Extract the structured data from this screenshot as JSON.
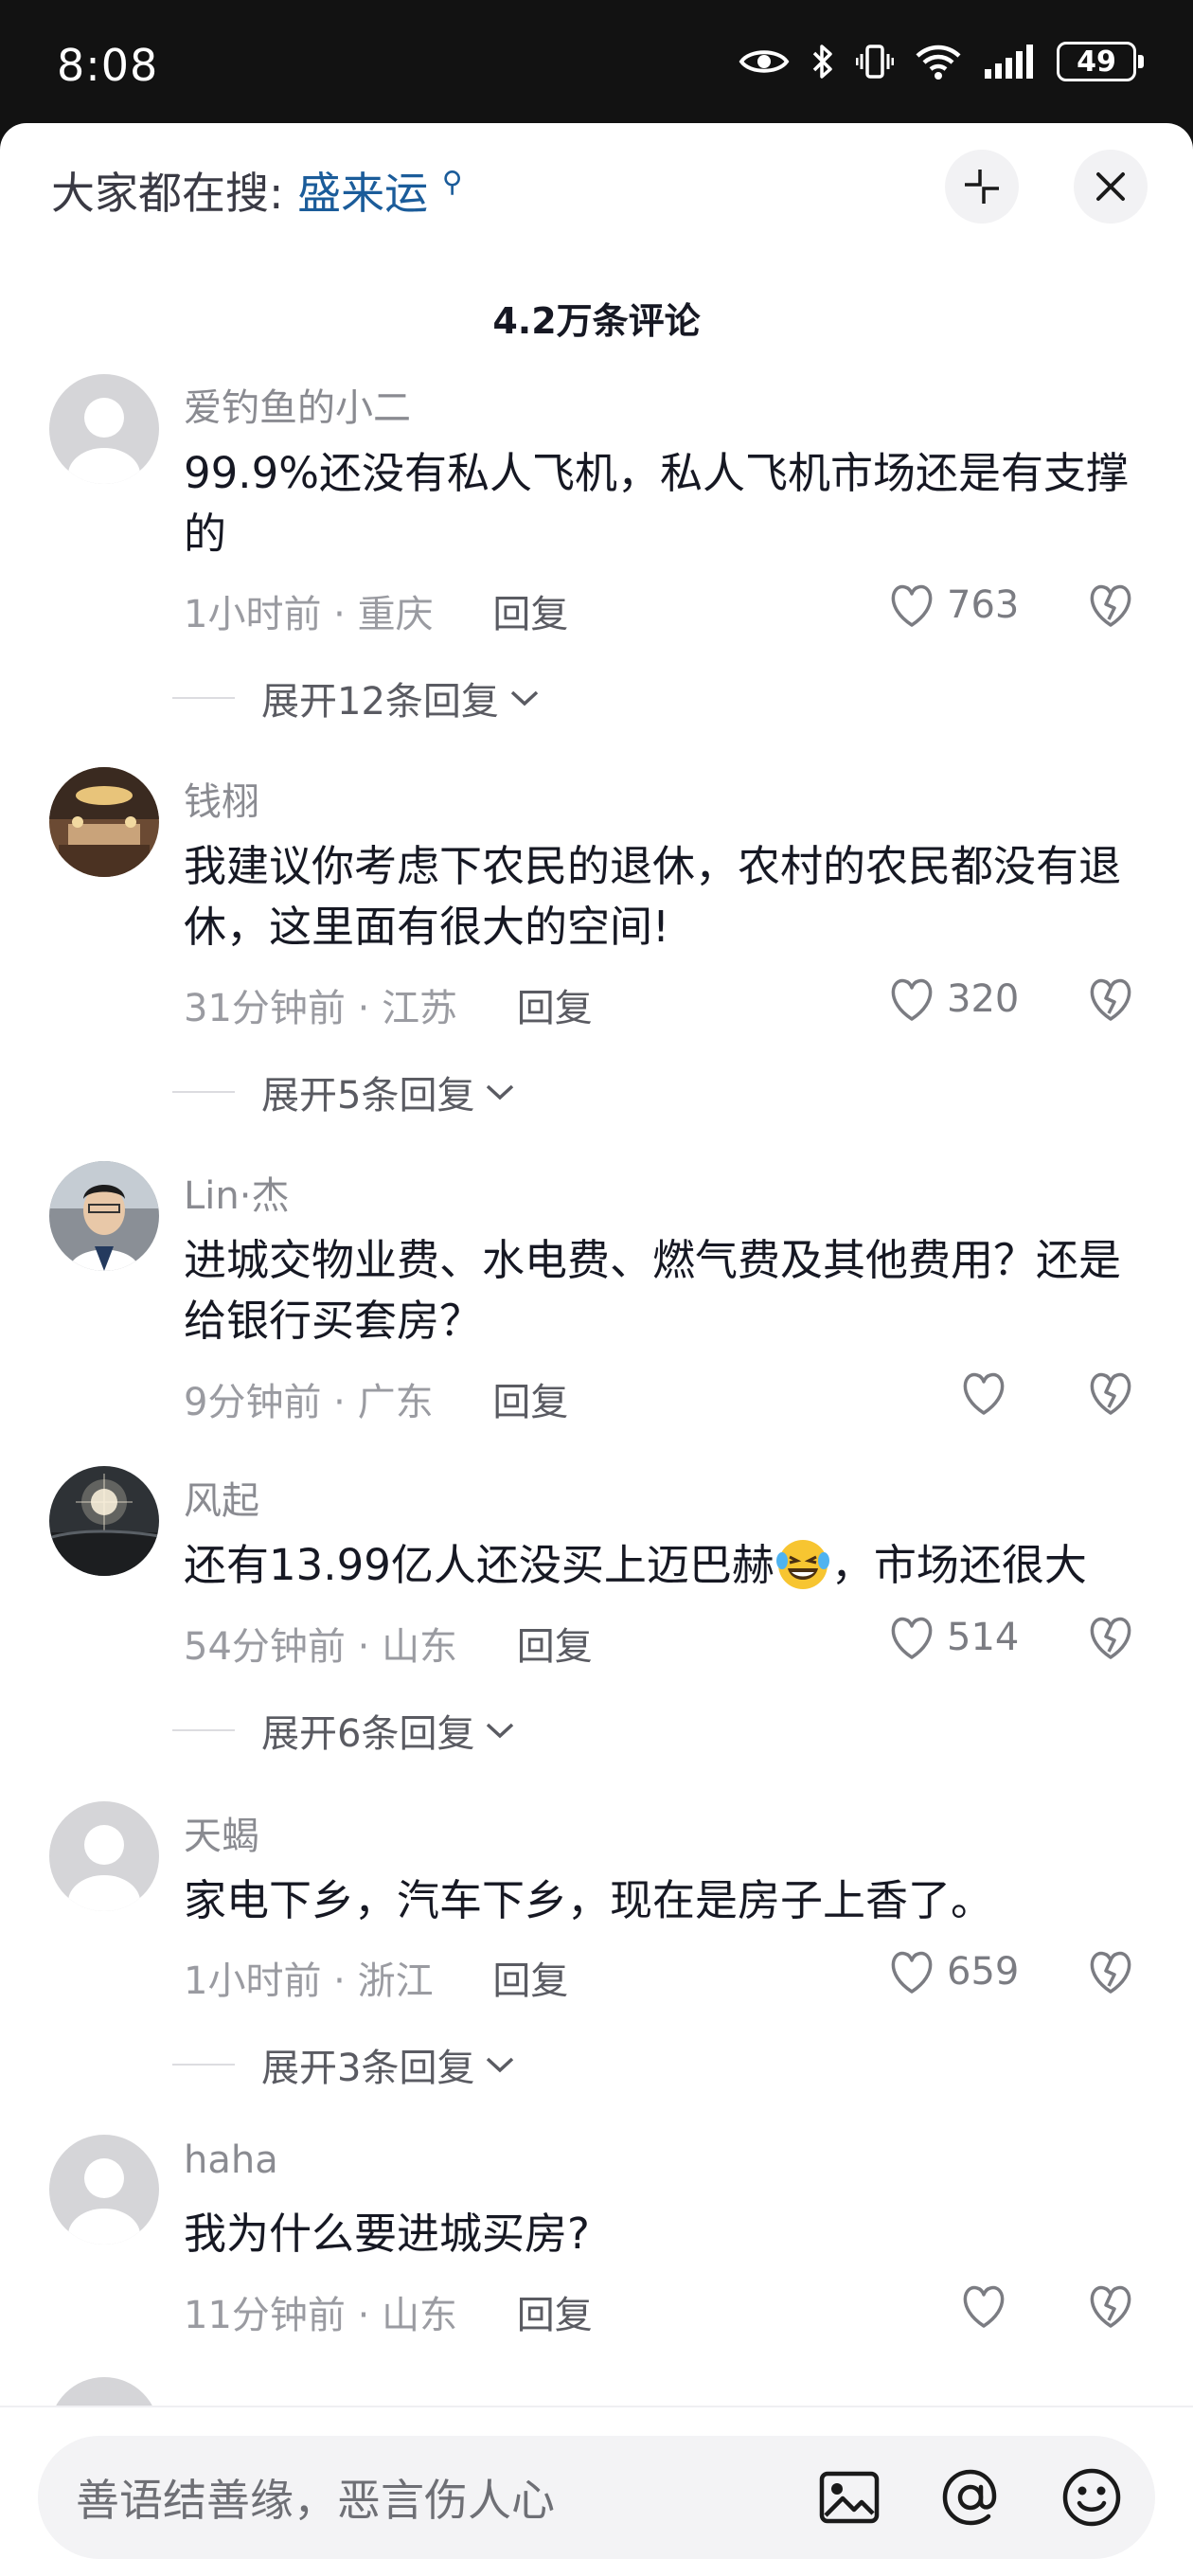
{
  "status": {
    "time": "8:08",
    "battery": "49"
  },
  "header": {
    "search_prefix": "大家都在搜:",
    "search_term": "盛来运",
    "comment_count": "4.2万条评论"
  },
  "comments": [
    {
      "username": "爱钓鱼的小二",
      "text": "99.9%还没有私人飞机，私人飞机市场还是有支撑的",
      "time": "1小时前",
      "location": "重庆",
      "reply": "回复",
      "likes": "763",
      "expand": "展开12条回复"
    },
    {
      "username": "钱栩",
      "text": "我建议你考虑下农民的退休，农村的农民都没有退休，这里面有很大的空间!",
      "time": "31分钟前",
      "location": "江苏",
      "reply": "回复",
      "likes": "320",
      "expand": "展开5条回复"
    },
    {
      "username": "Lin·杰",
      "text": "进城交物业费、水电费、燃气费及其他费用？还是给银行买套房？",
      "time": "9分钟前",
      "location": "广东",
      "reply": "回复",
      "likes": ""
    },
    {
      "username": "风起",
      "text": "还有13.99亿人还没买上迈巴赫",
      "text_after": "，市场还很大",
      "time": "54分钟前",
      "location": "山东",
      "reply": "回复",
      "likes": "514",
      "expand": "展开6条回复"
    },
    {
      "username": "天蝎",
      "text": "家电下乡，汽车下乡，现在是房子上香了。",
      "time": "1小时前",
      "location": "浙江",
      "reply": "回复",
      "likes": "659",
      "expand": "展开3条回复"
    },
    {
      "username": "haha",
      "text": "我为什么要进城买房?",
      "time": "11分钟前",
      "location": "山东",
      "reply": "回复",
      "likes": ""
    }
  ],
  "input": {
    "placeholder": "善语结善缘，恶言伤人心"
  },
  "icons": [
    "eye-icon",
    "bluetooth-icon",
    "vibrate-icon",
    "wifi-icon",
    "signal-icon",
    "battery-icon",
    "minimize-icon",
    "close-icon",
    "heart-icon",
    "broken-heart-icon",
    "chevron-down-icon",
    "image-icon",
    "at-icon",
    "emoji-icon",
    "laughing-emoji-icon"
  ]
}
